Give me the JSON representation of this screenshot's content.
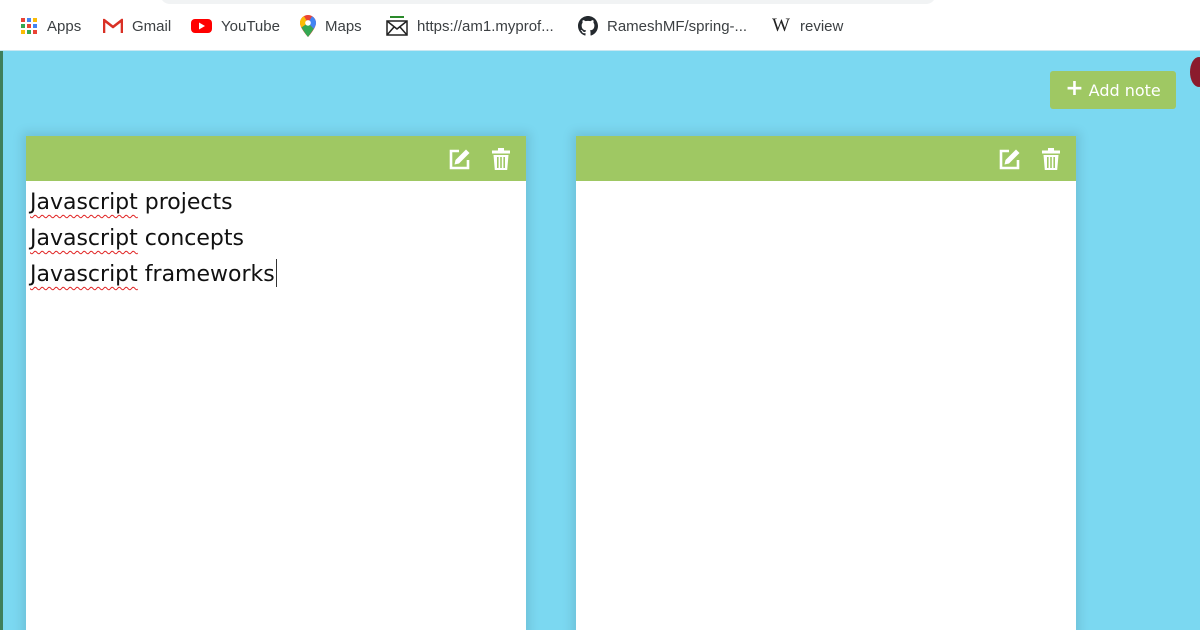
{
  "bookmarks": [
    {
      "label": "Apps",
      "icon": "apps-grid-icon"
    },
    {
      "label": "Gmail",
      "icon": "gmail-icon"
    },
    {
      "label": "YouTube",
      "icon": "youtube-icon"
    },
    {
      "label": "Maps",
      "icon": "maps-pin-icon"
    },
    {
      "label": "https://am1.myprof...",
      "icon": "envelope-icon"
    },
    {
      "label": "RameshMF/spring-...",
      "icon": "github-icon"
    },
    {
      "label": "review",
      "icon": "wikipedia-icon"
    }
  ],
  "app": {
    "background_color": "#7bd8f1",
    "accent_color": "#9fc863",
    "add_note_label": "Add note",
    "notes": [
      {
        "lines": [
          {
            "misspelled": "Javascript",
            "rest": " projects"
          },
          {
            "misspelled": "Javascript",
            "rest": " concepts"
          },
          {
            "misspelled": "Javascript",
            "rest": " frameworks"
          }
        ]
      },
      {
        "lines": []
      }
    ]
  }
}
